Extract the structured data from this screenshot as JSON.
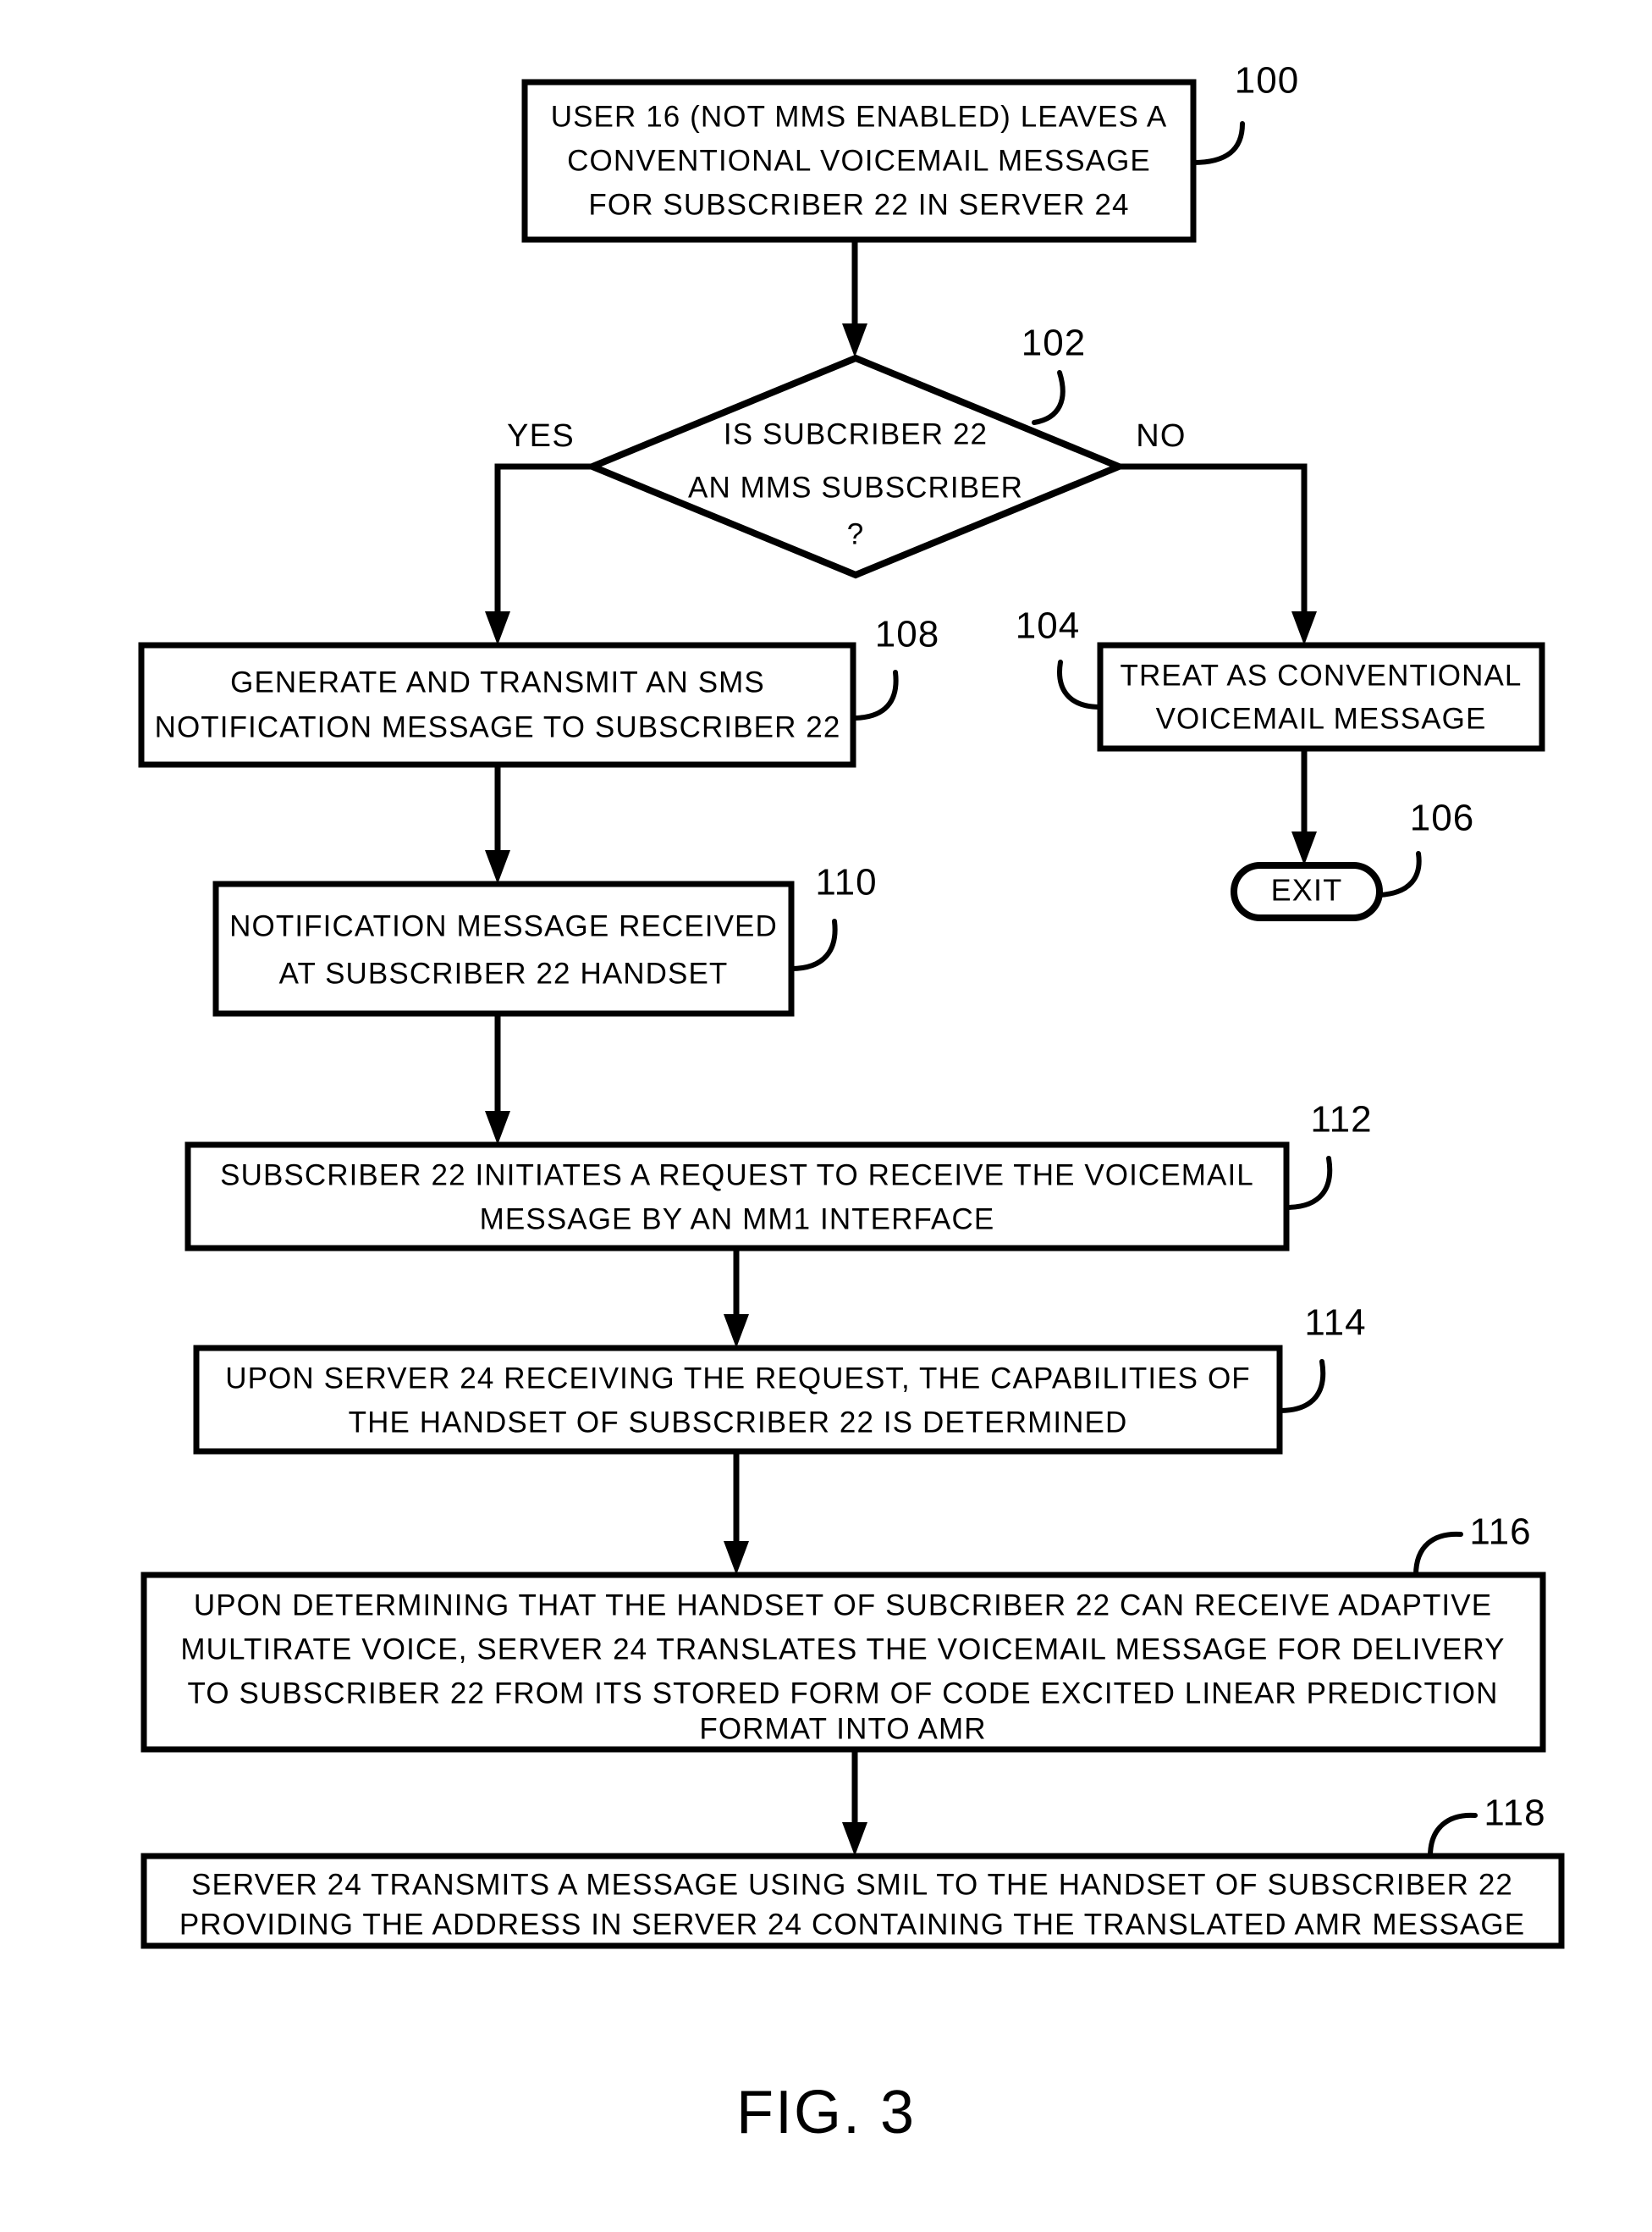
{
  "figure": {
    "caption": "FIG. 3",
    "type": "flowchart"
  },
  "nodes": {
    "n100": {
      "ref": "100",
      "shape": "process",
      "lines": [
        "USER 16 (NOT MMS ENABLED) LEAVES A",
        "CONVENTIONAL VOICEMAIL MESSAGE",
        "FOR SUBSCRIBER 22 IN SERVER 24"
      ]
    },
    "n102": {
      "ref": "102",
      "shape": "decision",
      "lines": [
        "IS SUBCRIBER 22",
        "AN MMS SUBSCRIBER",
        "?"
      ]
    },
    "n104": {
      "ref": "104",
      "shape": "process",
      "lines": [
        "TREAT AS CONVENTIONAL",
        "VOICEMAIL MESSAGE"
      ]
    },
    "n106": {
      "ref": "106",
      "shape": "terminal",
      "lines": [
        "EXIT"
      ]
    },
    "n108": {
      "ref": "108",
      "shape": "process",
      "lines": [
        "GENERATE AND TRANSMIT AN SMS",
        "NOTIFICATION MESSAGE TO SUBSCRIBER 22"
      ]
    },
    "n110": {
      "ref": "110",
      "shape": "process",
      "lines": [
        "NOTIFICATION MESSAGE RECEIVED",
        "AT SUBSCRIBER 22 HANDSET"
      ]
    },
    "n112": {
      "ref": "112",
      "shape": "process",
      "lines": [
        "SUBSCRIBER 22 INITIATES A REQUEST TO RECEIVE THE VOICEMAIL",
        "MESSAGE BY AN MM1 INTERFACE"
      ]
    },
    "n114": {
      "ref": "114",
      "shape": "process",
      "lines": [
        "UPON SERVER 24 RECEIVING THE REQUEST, THE CAPABILITIES OF",
        "THE HANDSET OF SUBSCRIBER 22 IS DETERMINED"
      ]
    },
    "n116": {
      "ref": "116",
      "shape": "process",
      "lines": [
        "UPON DETERMINING THAT THE HANDSET OF SUBCRIBER 22 CAN RECEIVE ADAPTIVE",
        "MULTIRATE VOICE, SERVER 24 TRANSLATES THE VOICEMAIL MESSAGE FOR DELIVERY",
        "TO SUBSCRIBER 22 FROM ITS STORED FORM OF CODE EXCITED LINEAR PREDICTION",
        "FORMAT INTO AMR"
      ]
    },
    "n118": {
      "ref": "118",
      "shape": "process",
      "lines": [
        "SERVER 24 TRANSMITS A MESSAGE USING SMIL TO THE HANDSET OF SUBSCRIBER 22",
        "PROVIDING THE ADDRESS IN SERVER 24 CONTAINING THE TRANSLATED AMR MESSAGE"
      ]
    }
  },
  "branch_labels": {
    "yes": "YES",
    "no": "NO"
  },
  "colors": {
    "ink": "#000000",
    "paper": "#ffffff"
  }
}
